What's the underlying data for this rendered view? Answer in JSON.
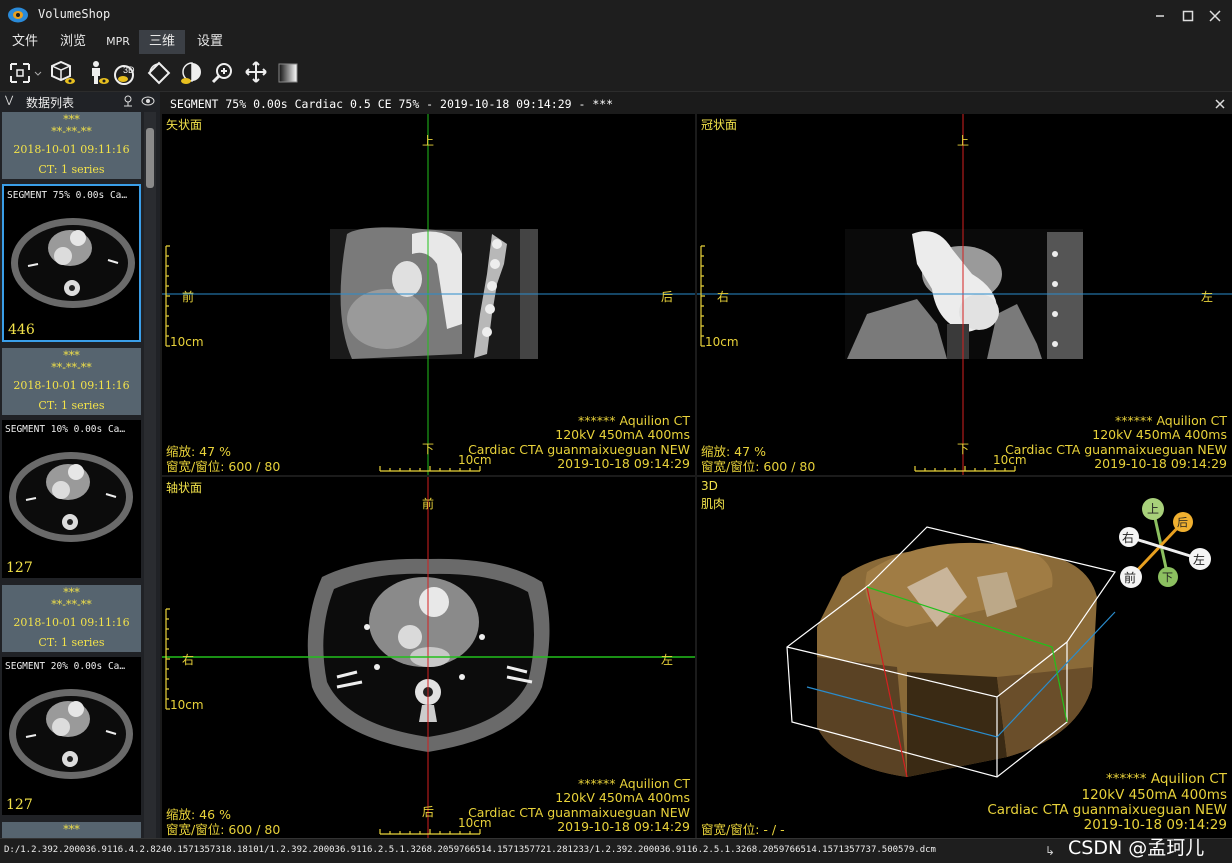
{
  "app": {
    "title": "VolumeShop"
  },
  "menu": [
    {
      "label": "文件"
    },
    {
      "label": "浏览"
    },
    {
      "label": "MPR"
    },
    {
      "label": "三维"
    },
    {
      "label": "设置"
    }
  ],
  "sidebar": {
    "title": "数据列表",
    "studies": [
      {
        "name": "***",
        "id": "**-**-**",
        "date": "2018-10-01  09:11:16",
        "info": "CT: 1 series",
        "series": "SEGMENT 75% 0.00s Ca…",
        "count": "446"
      },
      {
        "name": "***",
        "id": "**-**-**",
        "date": "2018-10-01  09:11:16",
        "info": "CT: 1 series",
        "series": "SEGMENT 10% 0.00s Ca…",
        "count": "127"
      },
      {
        "name": "***",
        "id": "**-**-**",
        "date": "2018-10-01  09:11:16",
        "info": "CT: 1 series",
        "series": "SEGMENT 20% 0.00s Ca…",
        "count": "127"
      },
      {
        "name": "***"
      }
    ]
  },
  "viewer": {
    "header": "SEGMENT 75% 0.00s Cardiac 0.5 CE 75% - 2019-10-18 09:14:29 - ***"
  },
  "views": {
    "sagittal": {
      "title": "矢状面",
      "top": "上",
      "bottom": "下",
      "left": "前",
      "right": "后",
      "scale": "10cm",
      "hscale": "10cm",
      "zoom": "缩放: 47 %",
      "window": "窗宽/窗位: 600 / 80",
      "info": [
        "****** Aquilion CT",
        "120kV 450mA 400ms",
        "Cardiac CTA guanmaixueguan NEW",
        "2019-10-18 09:14:29"
      ]
    },
    "coronal": {
      "title": "冠状面",
      "top": "上",
      "bottom": "下",
      "left": "右",
      "right": "左",
      "scale": "10cm",
      "hscale": "10cm",
      "zoom": "缩放: 47 %",
      "window": "窗宽/窗位: 600 / 80",
      "info": [
        "****** Aquilion CT",
        "120kV 450mA 400ms",
        "Cardiac CTA guanmaixueguan NEW",
        "2019-10-18 09:14:29"
      ]
    },
    "axial": {
      "title": "轴状面",
      "top": "前",
      "bottom": "后",
      "left": "右",
      "right": "左",
      "scale": "10cm",
      "hscale": "10cm",
      "zoom": "缩放: 46 %",
      "window": "窗宽/窗位: 600 / 80",
      "info": [
        "****** Aquilion CT",
        "120kV 450mA 400ms",
        "Cardiac CTA guanmaixueguan NEW",
        "2019-10-18 09:14:29"
      ]
    },
    "volume": {
      "title": "3D",
      "preset": "肌肉",
      "window": "窗宽/窗位: - / -",
      "info": [
        "****** Aquilion CT",
        "120kV 450mA 400ms",
        "Cardiac CTA guanmaixueguan NEW",
        "2019-10-18 09:14:29"
      ],
      "orientation": {
        "up": "上",
        "back": "后",
        "right": "右",
        "left": "左",
        "front": "前",
        "down": "下"
      }
    }
  },
  "status": {
    "path": "D:/1.2.392.200036.9116.4.2.8240.1571357318.18101/1.2.392.200036.9116.2.5.1.3268.2059766514.1571357721.281233/1.2.392.200036.9116.2.5.1.3268.2059766514.1571357737.500579.dcm",
    "watermark": "CSDN @孟珂儿"
  },
  "colors": {
    "accent_yellow": "#e8d23a",
    "crosshair_green": "#22c01c",
    "crosshair_red": "#d42020",
    "crosshair_blue": "#2a8ccc",
    "panel_bg": "#56646f",
    "selected_border": "#3a9ee8"
  }
}
